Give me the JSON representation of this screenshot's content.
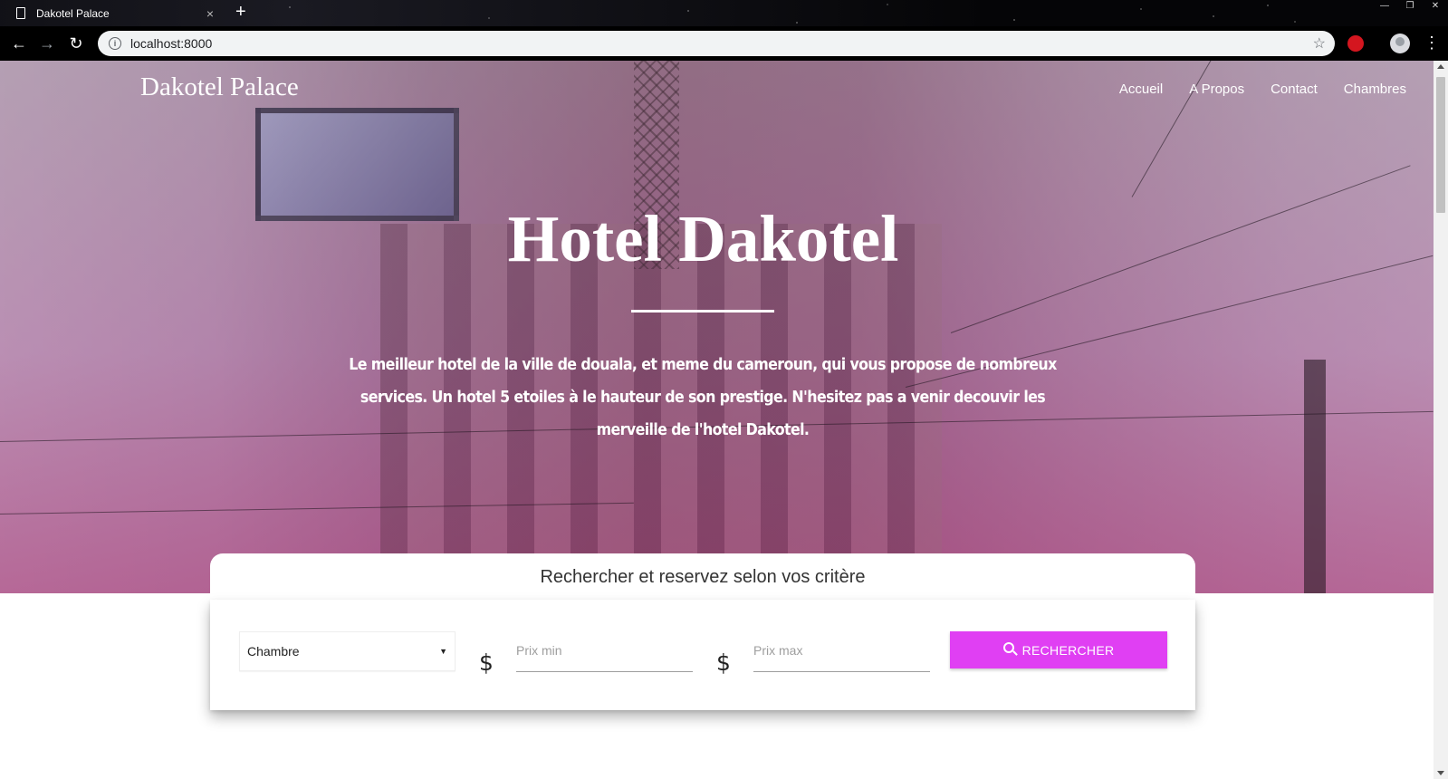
{
  "browser": {
    "tab_title": "Dakotel Palace",
    "tab_close": "×",
    "new_tab": "+",
    "url": "localhost:8000",
    "back": "←",
    "forward": "→",
    "reload": "↻",
    "star": "☆",
    "menu": "⋮",
    "window_controls": [
      "—",
      "❐",
      "✕"
    ]
  },
  "site": {
    "brand": "Dakotel Palace",
    "nav": [
      "Accueil",
      "A Propos",
      "Contact",
      "Chambres"
    ]
  },
  "hero": {
    "title": "Hotel Dakotel",
    "text": "Le meilleur hotel de la ville de douala, et meme du cameroun, qui vous propose de nombreux services. Un hotel 5 etoiles à le hauteur de son prestige. N'hesitez pas a venir decouvir les merveille de l'hotel Dakotel."
  },
  "search": {
    "heading": "Rechercher et reservez selon vos critère",
    "room_select": {
      "value": "Chambre",
      "caret": "▼"
    },
    "currency_symbol": "$",
    "price_min_placeholder": "Prix min",
    "price_max_placeholder": "Prix max",
    "button_label": "RECHERCHER",
    "button_color": "#e03ff3"
  }
}
